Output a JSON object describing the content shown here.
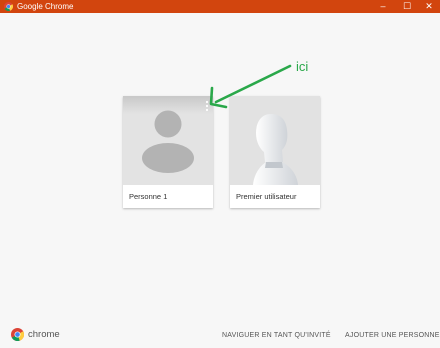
{
  "window": {
    "title": "Google Chrome",
    "minimize": "–",
    "maximize": "☐",
    "close": "✕",
    "titlebar_color": "#d2450e"
  },
  "profiles": [
    {
      "name": "Personne 1",
      "avatar": "default-person-avatar"
    },
    {
      "name": "Premier utilisateur",
      "avatar": "mannequin-bust-avatar"
    }
  ],
  "annotation": {
    "text": "ici",
    "color": "#2aa84a"
  },
  "footer": {
    "brand": "chrome",
    "guest_label": "NAVIGUER EN TANT QU'INVITÉ",
    "add_person_label": "AJOUTER UNE PERSONNE"
  }
}
